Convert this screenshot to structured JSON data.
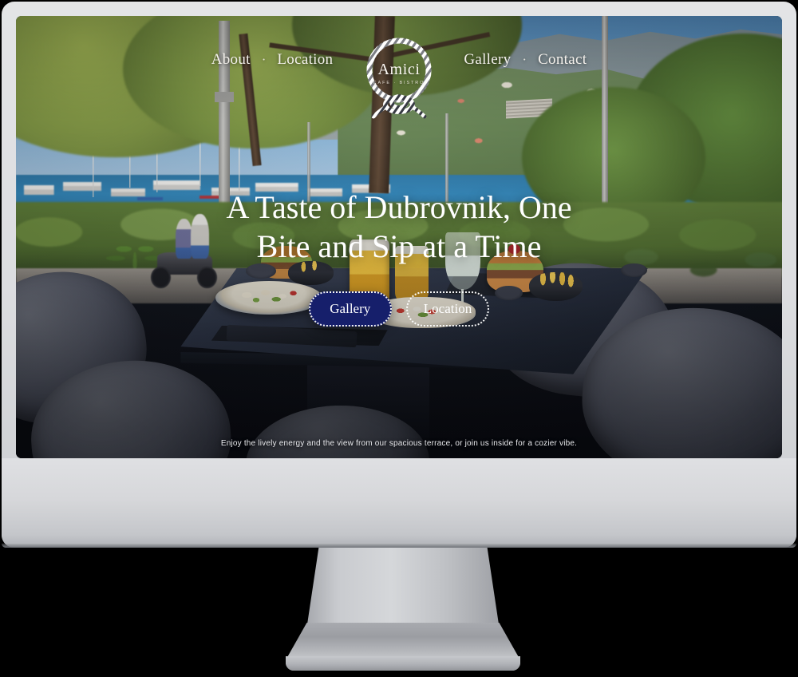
{
  "device": {
    "type": "desktop-monitor-mockup",
    "frame_color": "#dcdde0",
    "stand_color": "#b7b9bd"
  },
  "site": {
    "nav": {
      "left_items": [
        {
          "label": "About"
        },
        {
          "label": "Location"
        }
      ],
      "right_items": [
        {
          "label": "Gallery"
        },
        {
          "label": "Contact"
        }
      ],
      "separator": "·"
    },
    "logo": {
      "name": "Amici",
      "tagline": "CAFE · BISTRO",
      "mark": "rope-circle-knot-icon"
    },
    "hero": {
      "title_line_1": "A Taste of Dubrovnik, One",
      "title_line_2": "Bite and Sip at a Time",
      "buttons": [
        {
          "label": "Gallery",
          "style": "primary",
          "fill": "#161f6b"
        },
        {
          "label": "Location",
          "style": "ghost",
          "fill": "transparent"
        }
      ]
    },
    "caption": "Enjoy the lively energy and the view from our spacious terrace, or join us inside for a cozier vibe."
  },
  "colors": {
    "accent_navy": "#161f6b",
    "text_light": "#ffffff",
    "caption_text": "#e9eaee"
  }
}
